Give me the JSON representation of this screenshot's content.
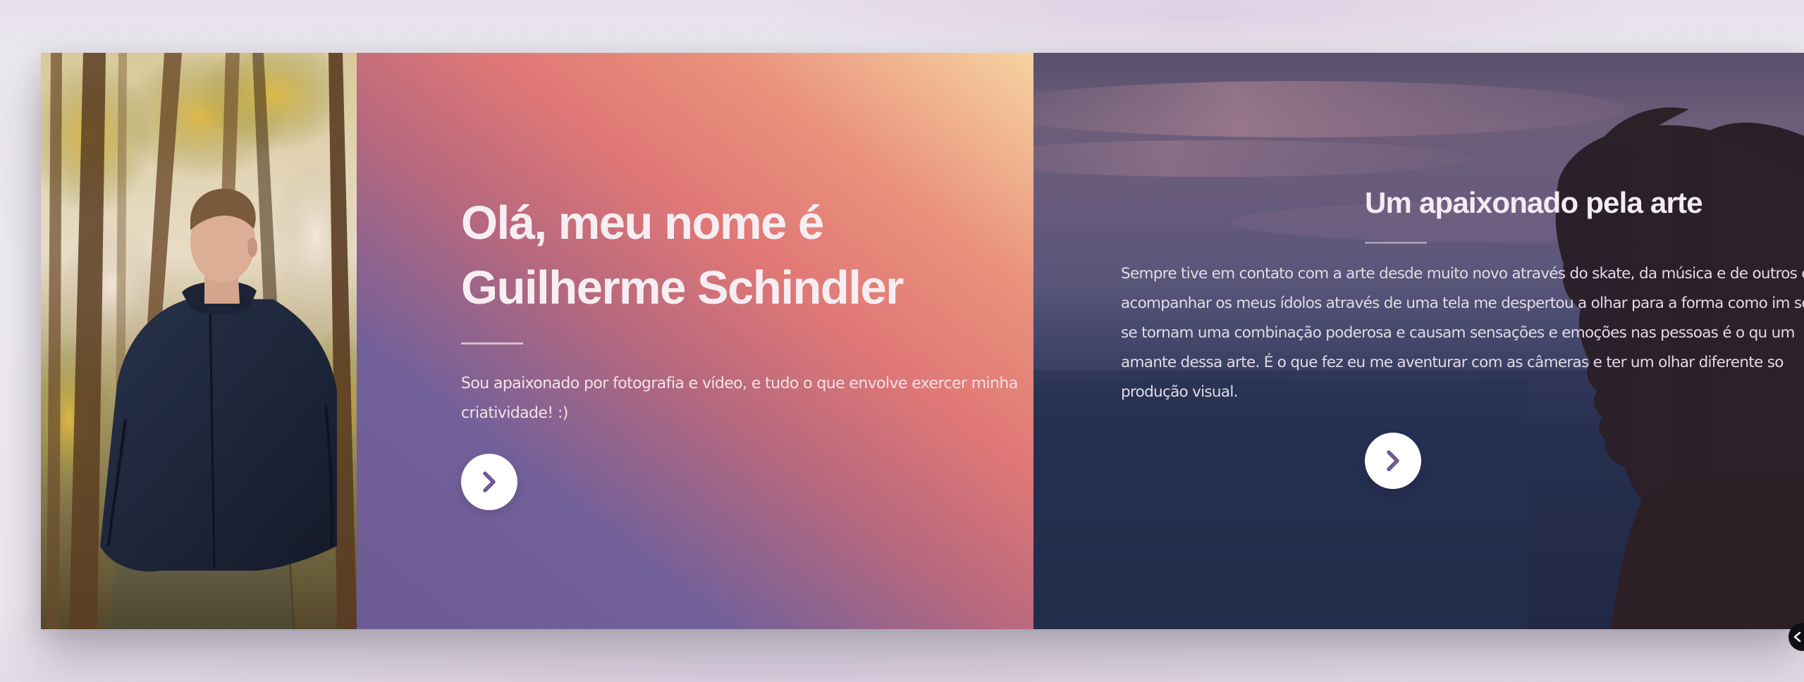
{
  "intro": {
    "title_line1": "Olá, meu nome é",
    "title_line2": "Guilherme Schindler",
    "description": "Sou apaixonado por fotografia e vídeo, e tudo o que envolve exercer minha criatividade! :)",
    "next_icon": "chevron-right-icon"
  },
  "art": {
    "title": "Um apaixonado pela arte",
    "description": "Sempre tive em contato com a arte desde muito novo através do skate, da música e de outros e acompanhar os meus ídolos através de uma tela me despertou a olhar para a forma como im sons se tornam uma combinação poderosa e causam sensações e emoções nas pessoas é o qu um amante dessa arte. É o que fez eu me aventurar com as câmeras e ter um olhar diferente so produção visual.",
    "next_icon": "chevron-right-icon"
  },
  "corner_widget": {
    "icon": "chevron-left-icon"
  },
  "colors": {
    "gradient_purple": "#6d5b95",
    "gradient_coral": "#e07876",
    "gradient_peach": "#f6d3a0",
    "button_bg": "#ffffff",
    "chevron": "#6d5b95",
    "text_light": "#f6eef2"
  }
}
